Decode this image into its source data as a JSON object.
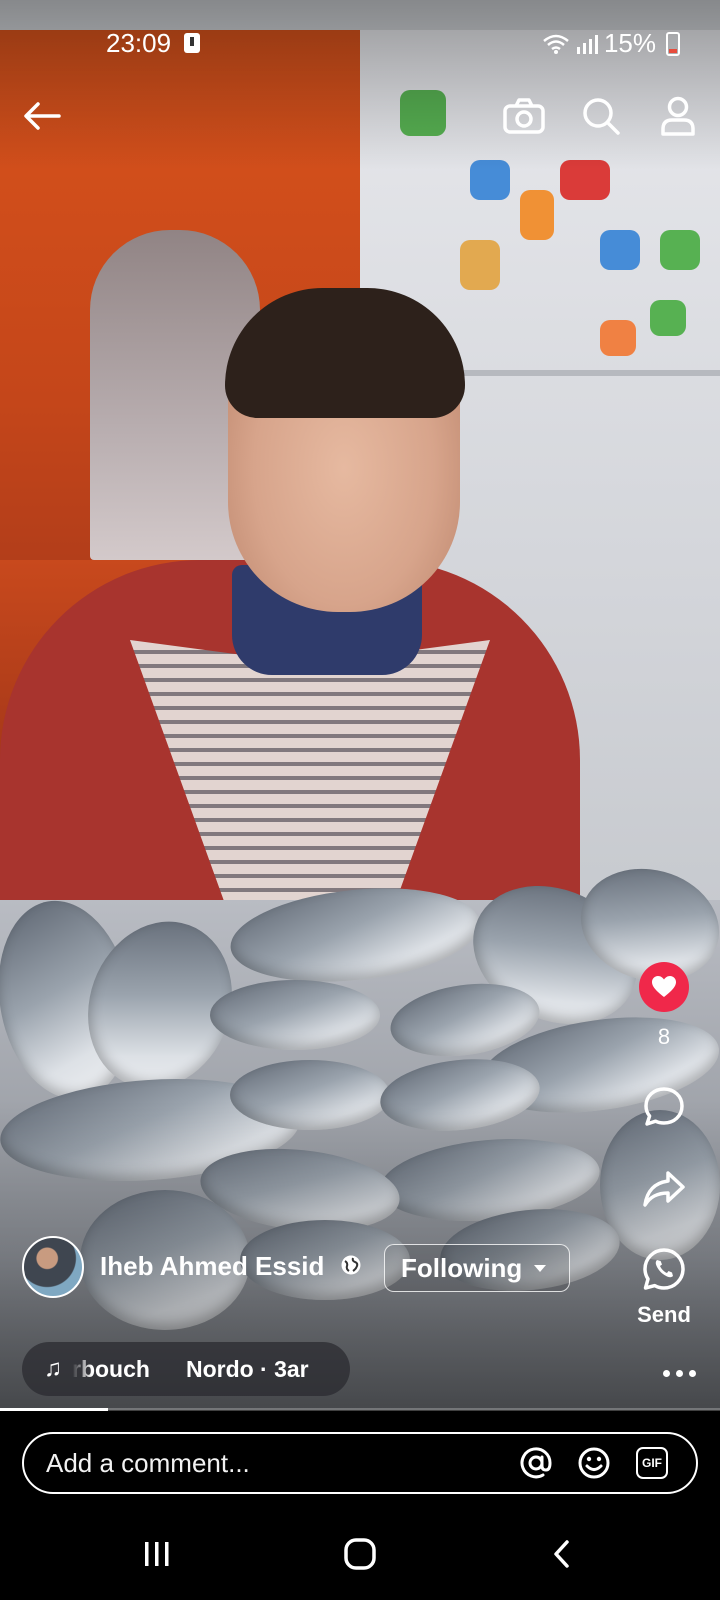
{
  "status_bar": {
    "time": "23:09",
    "battery": "15%"
  },
  "top_nav": {
    "back_icon": "arrow-left-icon",
    "camera_icon": "camera-icon",
    "search_icon": "search-icon",
    "profile_icon": "profile-icon"
  },
  "actions": {
    "like_count": "8",
    "send_label": "Send",
    "like_color": "#f0284a"
  },
  "author": {
    "name": "Iheb Ahmed Essid",
    "follow_label": "Following"
  },
  "music": {
    "track_part1": "rbouch",
    "track_part2": "Nordo · 3ar"
  },
  "progress": {
    "fraction": 0.15
  },
  "comment": {
    "placeholder": "Add a comment..."
  }
}
